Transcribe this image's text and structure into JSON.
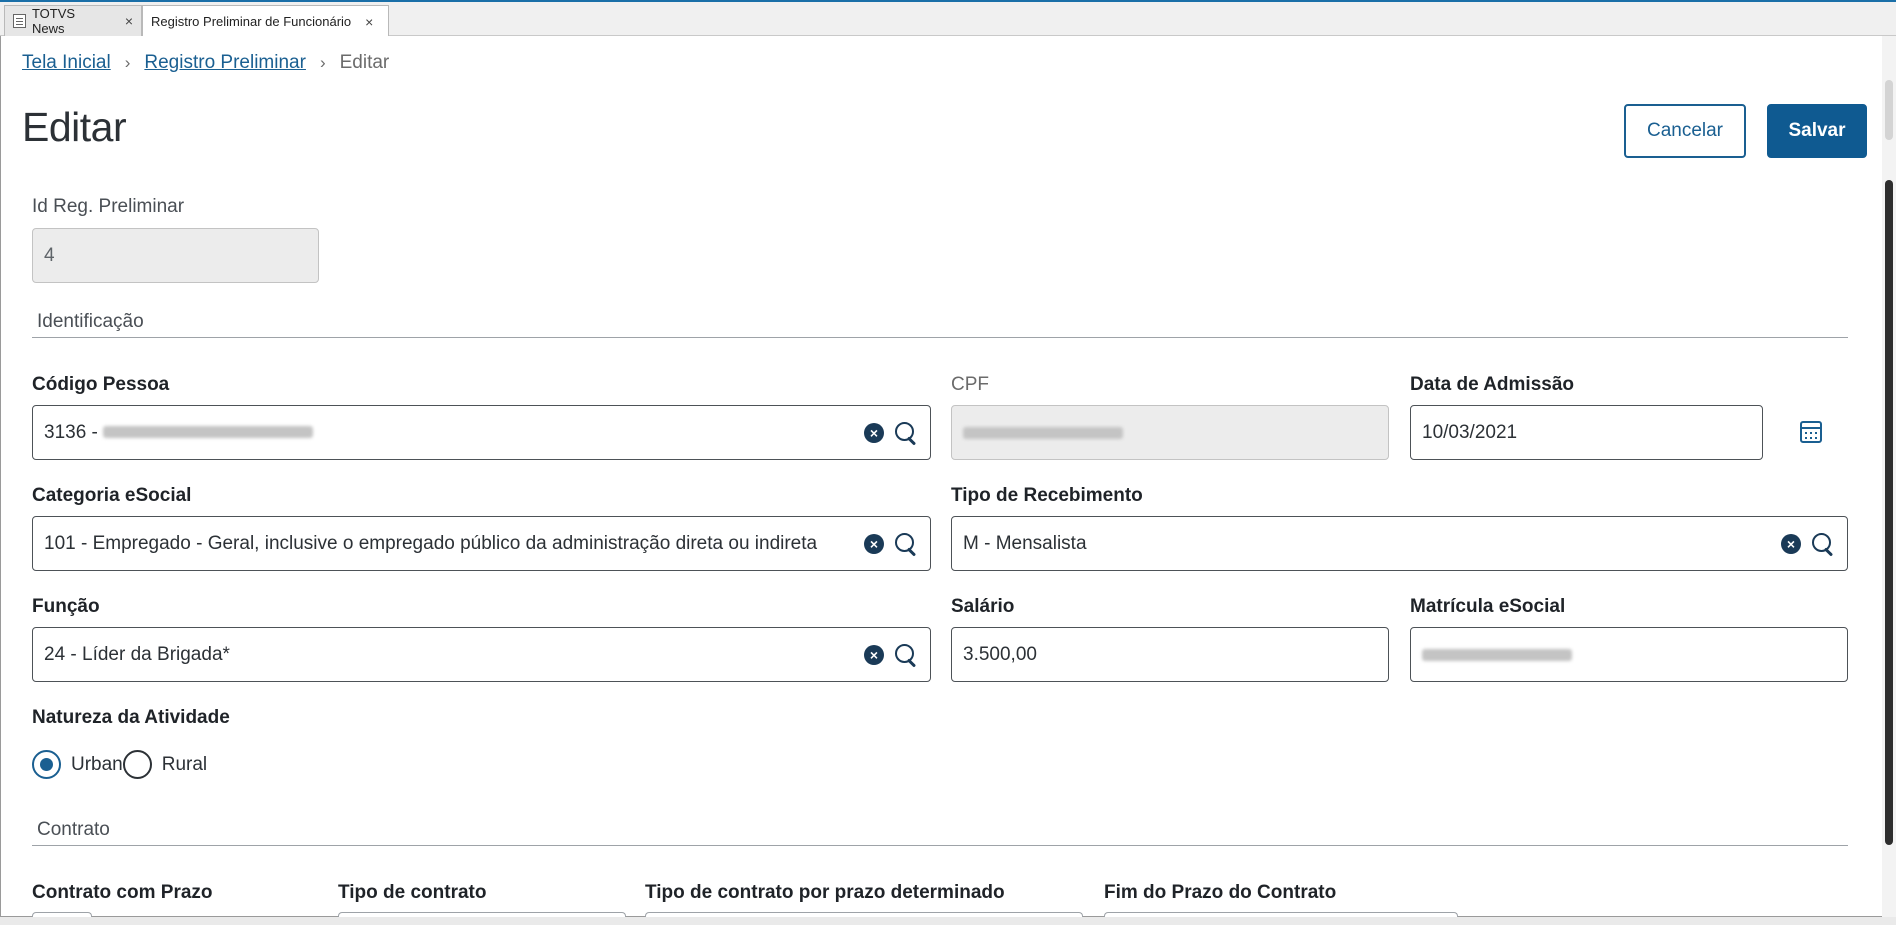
{
  "tabs": [
    {
      "label": "TOTVS News",
      "close": "×"
    },
    {
      "label": "Registro Preliminar de Funcionário",
      "close": "×"
    }
  ],
  "breadcrumb": {
    "home": "Tela Inicial",
    "parent": "Registro Preliminar",
    "current": "Editar",
    "separator": "›"
  },
  "page": {
    "title": "Editar",
    "cancel_label": "Cancelar",
    "save_label": "Salvar"
  },
  "fields": {
    "id_reg": {
      "label": "Id Reg. Preliminar",
      "value": "4"
    },
    "section_identificacao": "Identificação",
    "codigo_pessoa": {
      "label": "Código Pessoa",
      "value": "3136 - "
    },
    "cpf": {
      "label": "CPF"
    },
    "data_admissao": {
      "label": "Data de Admissão",
      "value": "10/03/2021"
    },
    "categoria": {
      "label": "Categoria eSocial",
      "value": "101 - Empregado - Geral, inclusive o empregado público da administração direta ou indireta"
    },
    "tipo_recebimento": {
      "label": "Tipo de Recebimento",
      "value": "M - Mensalista"
    },
    "funcao": {
      "label": "Função",
      "value": "24 - Líder da Brigada*"
    },
    "salario": {
      "label": "Salário",
      "value": "3.500,00"
    },
    "matricula": {
      "label": "Matrícula eSocial"
    },
    "natureza": {
      "label": "Natureza da Atividade",
      "options": [
        "Urban",
        "Rural"
      ],
      "selected": "Urban"
    },
    "section_contrato": "Contrato",
    "contrato_prazo": {
      "label": "Contrato com Prazo"
    },
    "tipo_contrato": {
      "label": "Tipo de contrato"
    },
    "tipo_contrato_prazo": {
      "label": "Tipo de contrato por prazo determinado"
    },
    "fim_prazo": {
      "label": "Fim do Prazo do Contrato"
    }
  },
  "colors": {
    "accent": "#1a5f91",
    "icon": "#1a3a57"
  },
  "icons": {
    "clear": "×"
  }
}
